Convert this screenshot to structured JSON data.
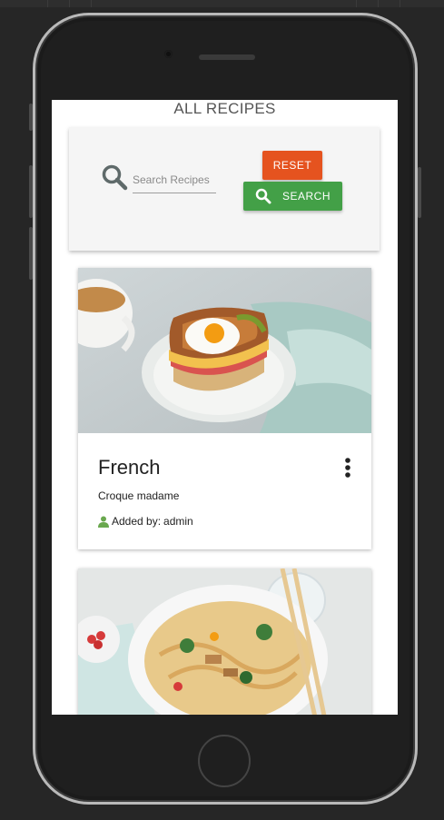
{
  "page": {
    "title": "ALL RECIPES"
  },
  "search": {
    "placeholder": "Search Recipes",
    "value": "",
    "reset_label": "RESET",
    "search_label": "SEARCH"
  },
  "recipes": [
    {
      "title": "French",
      "description": "Croque madame",
      "author_prefix": "Added by:",
      "author": "admin",
      "image_icon": "croque-madame-photo"
    },
    {
      "title": "",
      "description": "",
      "author_prefix": "",
      "author": "",
      "image_icon": "noodle-bowl-photo"
    }
  ],
  "colors": {
    "reset": "#e5531f",
    "search": "#43a047",
    "author_icon": "#6aa84f"
  }
}
